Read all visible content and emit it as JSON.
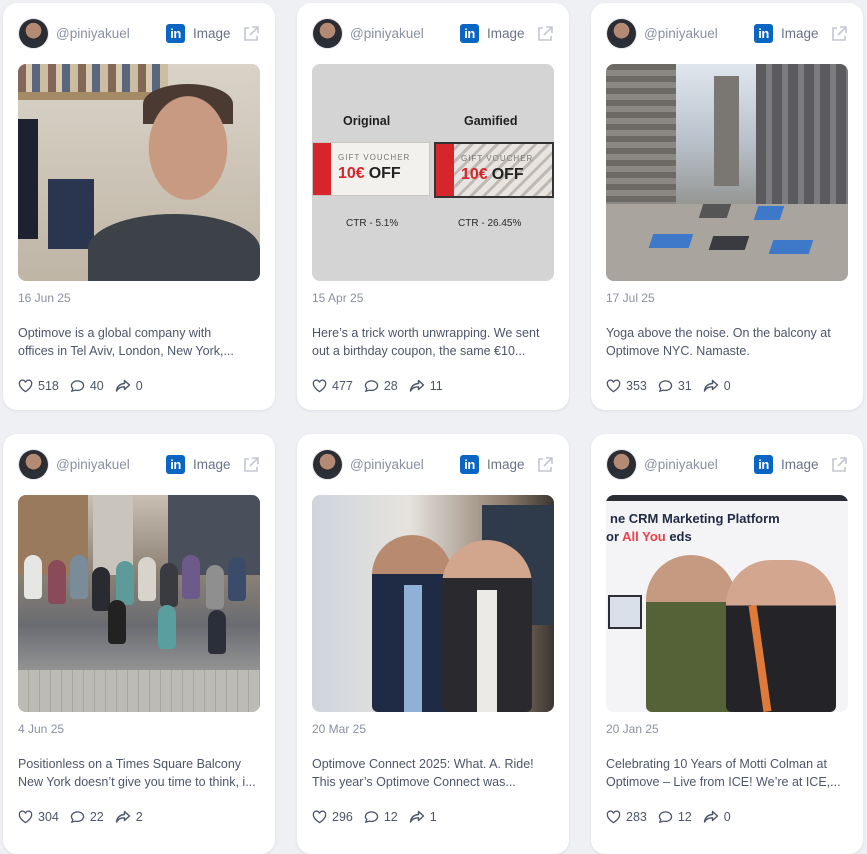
{
  "posts": [
    {
      "handle": "@piniyakuel",
      "type_label": "Image",
      "date": "16 Jun 25",
      "desc_line1": "Optimove is a global company with",
      "desc_line2": "offices in Tel Aviv, London, New York,...",
      "likes": "518",
      "comments": "40",
      "shares": "0"
    },
    {
      "handle": "@piniyakuel",
      "type_label": "Image",
      "date": "15 Apr 25",
      "desc_line1": "Here’s a trick worth unwrapping. We sent",
      "desc_line2": "out a birthday coupon, the same €10...",
      "likes": "477",
      "comments": "28",
      "shares": "11",
      "image": {
        "left_title": "Original",
        "right_title": "Gamified",
        "voucher_heading": "GIFT VOUCHER",
        "voucher_amount": "10€",
        "voucher_off": "OFF",
        "left_ctr": "CTR - 5.1%",
        "right_ctr": "CTR - 26.45%"
      }
    },
    {
      "handle": "@piniyakuel",
      "type_label": "Image",
      "date": "17 Jul 25",
      "desc_line1": "Yoga above the noise. On the balcony at",
      "desc_line2": "Optimove NYC. Namaste.",
      "likes": "353",
      "comments": "31",
      "shares": "0"
    },
    {
      "handle": "@piniyakuel",
      "type_label": "Image",
      "date": "4 Jun 25",
      "desc_line1": "Positionless on a Times Square Balcony",
      "desc_line2": "New York doesn’t give you time to think, i...",
      "likes": "304",
      "comments": "22",
      "shares": "2"
    },
    {
      "handle": "@piniyakuel",
      "type_label": "Image",
      "date": "20 Mar 25",
      "desc_line1": "Optimove Connect 2025: What. A. Ride!",
      "desc_line2": "This year’s Optimove Connect was...",
      "likes": "296",
      "comments": "12",
      "shares": "1"
    },
    {
      "handle": "@piniyakuel",
      "type_label": "Image",
      "date": "20 Jan 25",
      "desc_line1": "Celebrating 10 Years of Motti Colman at",
      "desc_line2": "Optimove – Live from ICE! We’re at ICE,...",
      "likes": "283",
      "comments": "12",
      "shares": "0",
      "image": {
        "banner_line1": "ne CRM Marketing Platform",
        "banner_line2_a": "or ",
        "banner_line2_b": "All You",
        "banner_line2_c": "    eds"
      }
    }
  ],
  "icons": {
    "network": "linkedin-icon",
    "external": "external-link-icon",
    "like": "heart-icon",
    "comment": "comment-icon",
    "share": "share-icon"
  },
  "colors": {
    "linkedin": "#0a66c2",
    "background": "#eef0f4",
    "card": "#ffffff"
  }
}
